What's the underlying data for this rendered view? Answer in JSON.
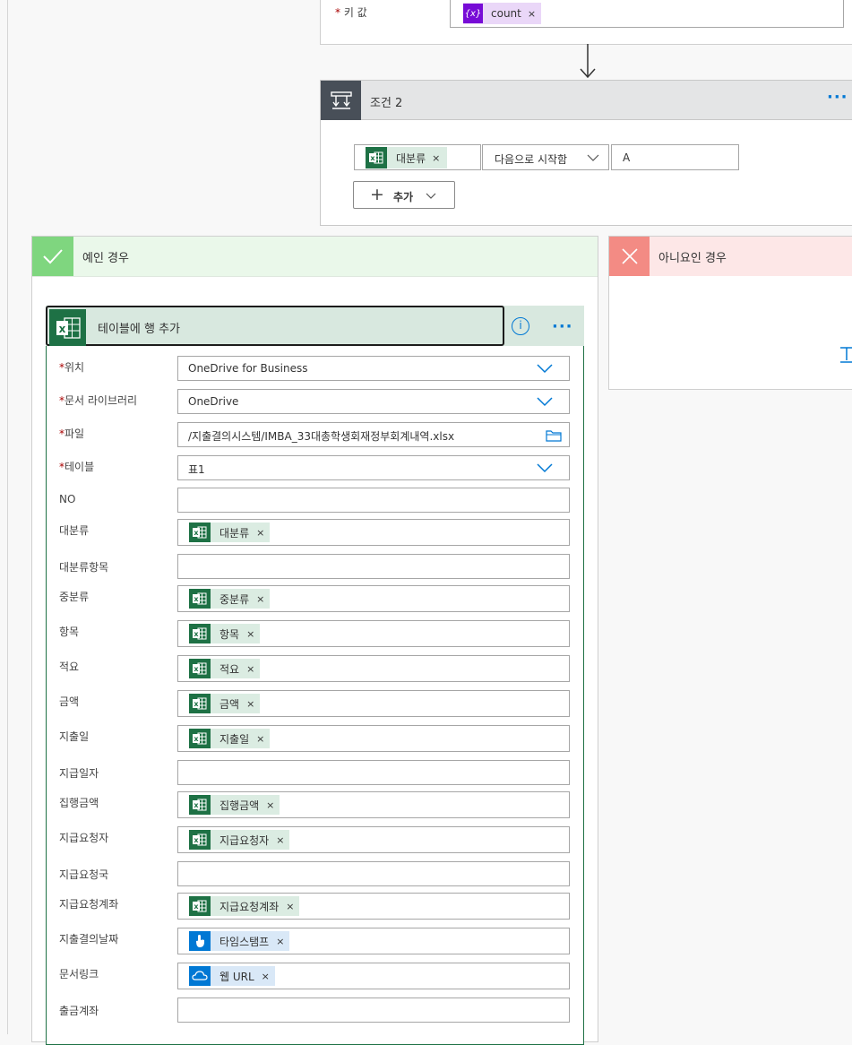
{
  "top_card": {
    "required_marker": "*",
    "key_label": "키 값",
    "token": {
      "label": "count",
      "icon": "variable-icon",
      "close": "×"
    }
  },
  "condition": {
    "title": "조건 2",
    "more": "···",
    "left_token": {
      "label": "대분류",
      "icon": "excel-icon",
      "close": "×"
    },
    "operator": "다음으로 시작함",
    "value": "A",
    "add_label": "추가",
    "add_plus": "+"
  },
  "yes_branch": {
    "title": "예인 경우"
  },
  "no_branch": {
    "title": "아니요인 경우"
  },
  "action": {
    "title": "테이블에 행 추가",
    "info": "i",
    "more": "···",
    "fields": [
      {
        "label": "위치",
        "required": true,
        "type": "dropdown",
        "value": "OneDrive for Business"
      },
      {
        "label": "문서 라이브러리",
        "required": true,
        "type": "dropdown",
        "value": "OneDrive"
      },
      {
        "label": "파일",
        "required": true,
        "type": "file",
        "value": "/지출결의시스템/IMBA_33대총학생회재정부회계내역.xlsx"
      },
      {
        "label": "테이블",
        "required": true,
        "type": "dropdown",
        "value": "표1"
      },
      {
        "label": "NO",
        "required": false,
        "type": "empty",
        "value": ""
      },
      {
        "label": "대분류",
        "required": false,
        "type": "token",
        "value": "대분류",
        "icon": "excel-icon"
      },
      {
        "label": "대분류항목",
        "required": false,
        "type": "empty",
        "value": ""
      },
      {
        "label": "중분류",
        "required": false,
        "type": "token",
        "value": "중분류",
        "icon": "excel-icon"
      },
      {
        "label": "항목",
        "required": false,
        "type": "token",
        "value": "항목",
        "icon": "excel-icon"
      },
      {
        "label": "적요",
        "required": false,
        "type": "token",
        "value": "적요",
        "icon": "excel-icon"
      },
      {
        "label": "금액",
        "required": false,
        "type": "token",
        "value": "금액",
        "icon": "excel-icon"
      },
      {
        "label": "지출일",
        "required": false,
        "type": "token",
        "value": "지출일",
        "icon": "excel-icon"
      },
      {
        "label": "지급일자",
        "required": false,
        "type": "empty",
        "value": ""
      },
      {
        "label": "집행금액",
        "required": false,
        "type": "token",
        "value": "집행금액",
        "icon": "excel-icon"
      },
      {
        "label": "지급요청자",
        "required": false,
        "type": "token",
        "value": "지급요청자",
        "icon": "excel-icon"
      },
      {
        "label": "지급요청국",
        "required": false,
        "type": "empty",
        "value": ""
      },
      {
        "label": "지급요청계좌",
        "required": false,
        "type": "token",
        "value": "지급요청계좌",
        "icon": "excel-icon"
      },
      {
        "label": "지출결의날짜",
        "required": false,
        "type": "token",
        "value": "타임스탬프",
        "icon": "trigger-hand-icon"
      },
      {
        "label": "문서링크",
        "required": false,
        "type": "token",
        "value": "웹 URL",
        "icon": "onedrive-cloud-icon"
      },
      {
        "label": "출금계좌",
        "required": false,
        "type": "empty",
        "value": ""
      }
    ]
  },
  "colors": {
    "excel_green": "#1e7145",
    "variable_purple": "#770bd6",
    "accent_blue": "#0078d4",
    "yes_green": "#7fd67f",
    "no_red": "#f38b84"
  }
}
